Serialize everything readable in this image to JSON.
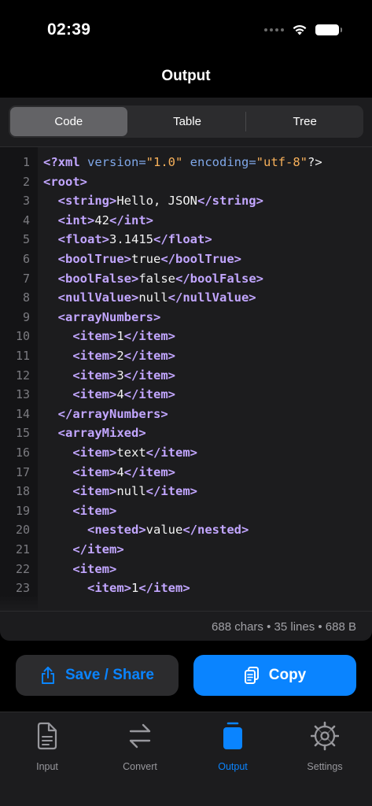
{
  "status": {
    "time": "02:39"
  },
  "nav": {
    "title": "Output"
  },
  "segments": [
    {
      "label": "Code",
      "active": true
    },
    {
      "label": "Table",
      "active": false
    },
    {
      "label": "Tree",
      "active": false
    }
  ],
  "code_lines": [
    [
      {
        "t": "tag",
        "v": "<?xml "
      },
      {
        "t": "attr",
        "v": "version="
      },
      {
        "t": "val",
        "v": "\"1.0\""
      },
      {
        "t": "txt",
        "v": " "
      },
      {
        "t": "attr",
        "v": "encoding="
      },
      {
        "t": "val",
        "v": "\"utf-8\""
      },
      {
        "t": "txt",
        "v": "?>"
      }
    ],
    [
      {
        "t": "tag",
        "v": "<root>"
      }
    ],
    [
      {
        "t": "txt",
        "v": "  "
      },
      {
        "t": "tag",
        "v": "<string>"
      },
      {
        "t": "txt",
        "v": "Hello, JSON"
      },
      {
        "t": "tag",
        "v": "</string>"
      }
    ],
    [
      {
        "t": "txt",
        "v": "  "
      },
      {
        "t": "tag",
        "v": "<int>"
      },
      {
        "t": "txt",
        "v": "42"
      },
      {
        "t": "tag",
        "v": "</int>"
      }
    ],
    [
      {
        "t": "txt",
        "v": "  "
      },
      {
        "t": "tag",
        "v": "<float>"
      },
      {
        "t": "txt",
        "v": "3.1415"
      },
      {
        "t": "tag",
        "v": "</float>"
      }
    ],
    [
      {
        "t": "txt",
        "v": "  "
      },
      {
        "t": "tag",
        "v": "<boolTrue>"
      },
      {
        "t": "txt",
        "v": "true"
      },
      {
        "t": "tag",
        "v": "</boolTrue>"
      }
    ],
    [
      {
        "t": "txt",
        "v": "  "
      },
      {
        "t": "tag",
        "v": "<boolFalse>"
      },
      {
        "t": "txt",
        "v": "false"
      },
      {
        "t": "tag",
        "v": "</boolFalse>"
      }
    ],
    [
      {
        "t": "txt",
        "v": "  "
      },
      {
        "t": "tag",
        "v": "<nullValue>"
      },
      {
        "t": "txt",
        "v": "null"
      },
      {
        "t": "tag",
        "v": "</nullValue>"
      }
    ],
    [
      {
        "t": "txt",
        "v": "  "
      },
      {
        "t": "tag",
        "v": "<arrayNumbers>"
      }
    ],
    [
      {
        "t": "txt",
        "v": "    "
      },
      {
        "t": "tag",
        "v": "<item>"
      },
      {
        "t": "txt",
        "v": "1"
      },
      {
        "t": "tag",
        "v": "</item>"
      }
    ],
    [
      {
        "t": "txt",
        "v": "    "
      },
      {
        "t": "tag",
        "v": "<item>"
      },
      {
        "t": "txt",
        "v": "2"
      },
      {
        "t": "tag",
        "v": "</item>"
      }
    ],
    [
      {
        "t": "txt",
        "v": "    "
      },
      {
        "t": "tag",
        "v": "<item>"
      },
      {
        "t": "txt",
        "v": "3"
      },
      {
        "t": "tag",
        "v": "</item>"
      }
    ],
    [
      {
        "t": "txt",
        "v": "    "
      },
      {
        "t": "tag",
        "v": "<item>"
      },
      {
        "t": "txt",
        "v": "4"
      },
      {
        "t": "tag",
        "v": "</item>"
      }
    ],
    [
      {
        "t": "txt",
        "v": "  "
      },
      {
        "t": "tag",
        "v": "</arrayNumbers>"
      }
    ],
    [
      {
        "t": "txt",
        "v": "  "
      },
      {
        "t": "tag",
        "v": "<arrayMixed>"
      }
    ],
    [
      {
        "t": "txt",
        "v": "    "
      },
      {
        "t": "tag",
        "v": "<item>"
      },
      {
        "t": "txt",
        "v": "text"
      },
      {
        "t": "tag",
        "v": "</item>"
      }
    ],
    [
      {
        "t": "txt",
        "v": "    "
      },
      {
        "t": "tag",
        "v": "<item>"
      },
      {
        "t": "txt",
        "v": "4"
      },
      {
        "t": "tag",
        "v": "</item>"
      }
    ],
    [
      {
        "t": "txt",
        "v": "    "
      },
      {
        "t": "tag",
        "v": "<item>"
      },
      {
        "t": "txt",
        "v": "null"
      },
      {
        "t": "tag",
        "v": "</item>"
      }
    ],
    [
      {
        "t": "txt",
        "v": "    "
      },
      {
        "t": "tag",
        "v": "<item>"
      }
    ],
    [
      {
        "t": "txt",
        "v": "      "
      },
      {
        "t": "tag",
        "v": "<nested>"
      },
      {
        "t": "txt",
        "v": "value"
      },
      {
        "t": "tag",
        "v": "</nested>"
      }
    ],
    [
      {
        "t": "txt",
        "v": "    "
      },
      {
        "t": "tag",
        "v": "</item>"
      }
    ],
    [
      {
        "t": "txt",
        "v": "    "
      },
      {
        "t": "tag",
        "v": "<item>"
      }
    ],
    [
      {
        "t": "txt",
        "v": "      "
      },
      {
        "t": "tag",
        "v": "<item>"
      },
      {
        "t": "txt",
        "v": "1"
      },
      {
        "t": "tag",
        "v": "</item>"
      }
    ]
  ],
  "stats": "688 chars • 35 lines • 688 B",
  "actions": {
    "share_label": "Save / Share",
    "copy_label": "Copy"
  },
  "tabs": [
    {
      "label": "Input",
      "icon": "document-icon",
      "active": false
    },
    {
      "label": "Convert",
      "icon": "arrows-icon",
      "active": false
    },
    {
      "label": "Output",
      "icon": "output-icon",
      "active": true
    },
    {
      "label": "Settings",
      "icon": "gear-icon",
      "active": false
    }
  ],
  "colors": {
    "accent": "#0a84ff",
    "tag": "#c2a6ff",
    "attr": "#7fa7e8",
    "string": "#f7b05a"
  }
}
